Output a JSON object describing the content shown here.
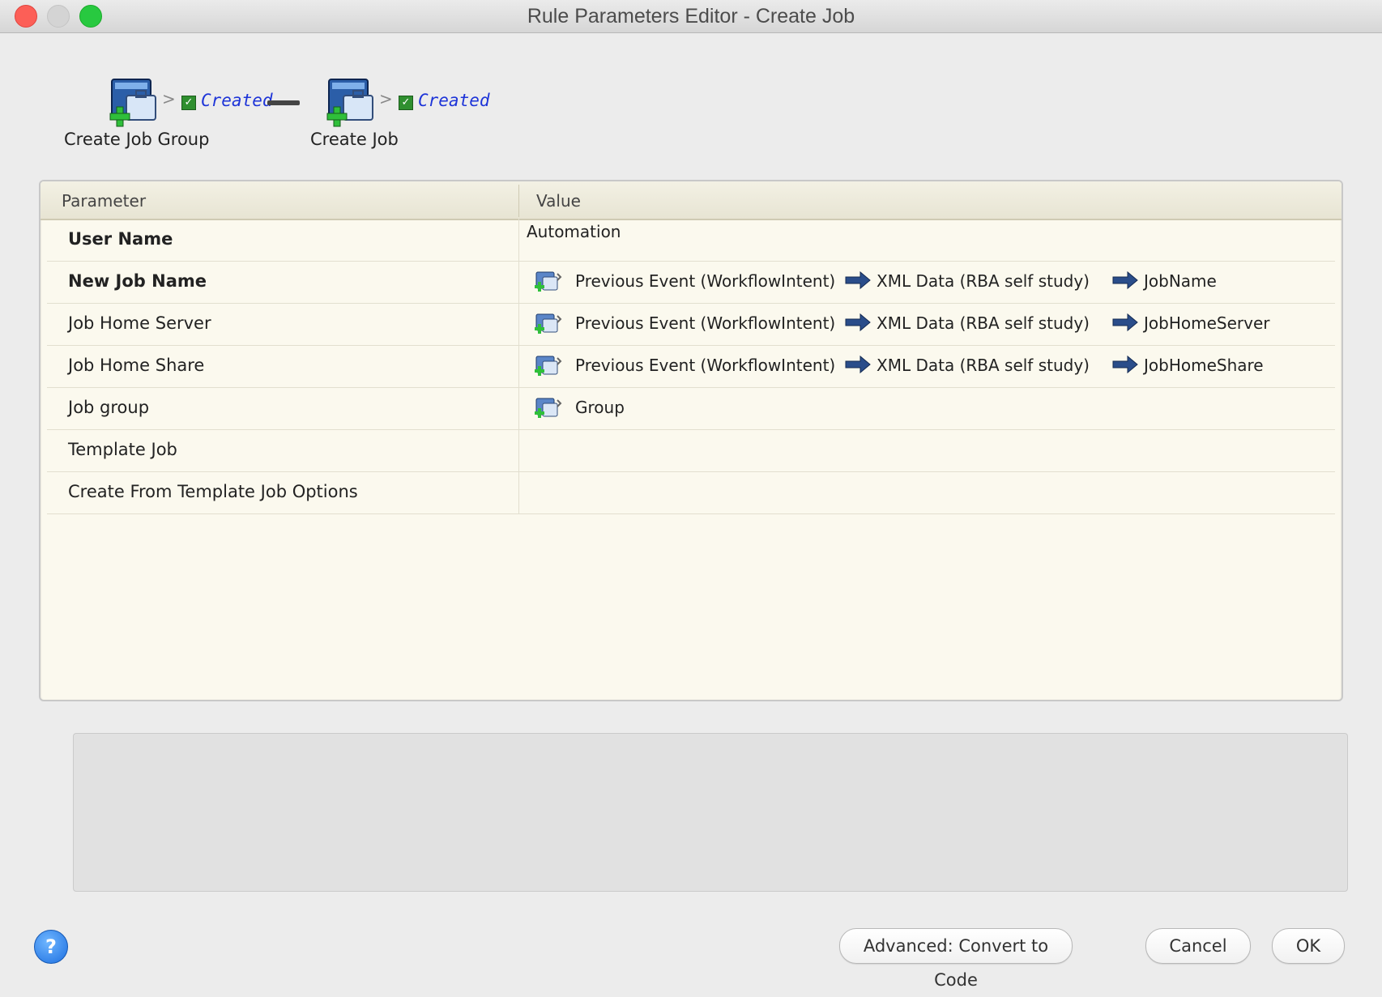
{
  "window": {
    "title": "Rule Parameters Editor - Create Job"
  },
  "workflow": {
    "steps": [
      {
        "label": "Create Job Group",
        "status": "Created"
      },
      {
        "label": "Create Job",
        "status": "Created"
      }
    ]
  },
  "table": {
    "headers": {
      "parameter": "Parameter",
      "value": "Value"
    },
    "rows": [
      {
        "param": "User Name",
        "bold": true,
        "value": "Automation"
      },
      {
        "param": "New Job Name",
        "bold": true,
        "value_parts": [
          "Previous Event (WorkflowIntent)",
          "XML Data (RBA self study)",
          "JobName"
        ]
      },
      {
        "param": "Job Home Server",
        "bold": false,
        "value_parts": [
          "Previous Event (WorkflowIntent)",
          "XML Data (RBA self study)",
          "JobHomeServer"
        ]
      },
      {
        "param": "Job Home Share",
        "bold": false,
        "value_parts": [
          "Previous Event (WorkflowIntent)",
          "XML Data (RBA self study)",
          "JobHomeShare"
        ]
      },
      {
        "param": "Job group",
        "bold": false,
        "value_parts": [
          "Group"
        ]
      },
      {
        "param": "Template Job",
        "bold": false,
        "value": ""
      },
      {
        "param": "Create From Template Job Options",
        "bold": false,
        "value": ""
      }
    ]
  },
  "buttons": {
    "help": "?",
    "advanced": "Advanced: Convert to Code",
    "cancel": "Cancel",
    "ok": "OK"
  },
  "colors": {
    "status_blue": "#1d34d8",
    "table_bg": "#fbf9ee",
    "help_blue": "#1d6fe0"
  }
}
